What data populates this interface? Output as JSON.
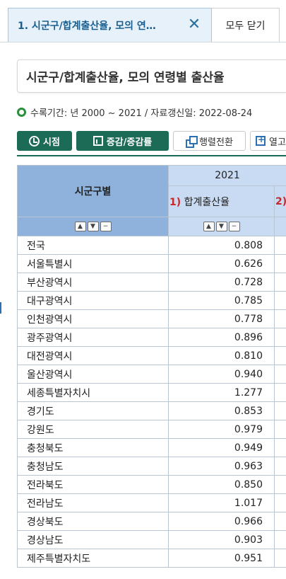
{
  "tabs": {
    "active_label": "1. 시군구/합계출산율, 모의 연…",
    "close_icon": "close-icon",
    "close_all_label": "모두 닫기"
  },
  "title": "시군구/합계출산율, 모의 연령별 출산율",
  "meta": {
    "text": "수록기간: 년 2000 ~ 2021 / 자료갱신일: 2022-08-24"
  },
  "toolbar": {
    "time_label": "시점",
    "change_label": "증감/증감률",
    "pivot_label": "행렬전환",
    "cols_label": "열고"
  },
  "table": {
    "region_header": "시군구별",
    "year": "2021",
    "col1_num": "1)",
    "col1_label": "합계출산율",
    "col2_num": "2)",
    "rows": [
      {
        "name": "전국",
        "value": "0.808"
      },
      {
        "name": "서울특별시",
        "value": "0.626"
      },
      {
        "name": "부산광역시",
        "value": "0.728"
      },
      {
        "name": "대구광역시",
        "value": "0.785"
      },
      {
        "name": "인천광역시",
        "value": "0.778"
      },
      {
        "name": "광주광역시",
        "value": "0.896"
      },
      {
        "name": "대전광역시",
        "value": "0.810"
      },
      {
        "name": "울산광역시",
        "value": "0.940"
      },
      {
        "name": "세종특별자치시",
        "value": "1.277"
      },
      {
        "name": "경기도",
        "value": "0.853"
      },
      {
        "name": "강원도",
        "value": "0.979"
      },
      {
        "name": "충청북도",
        "value": "0.949"
      },
      {
        "name": "충청남도",
        "value": "0.963"
      },
      {
        "name": "전라북도",
        "value": "0.850"
      },
      {
        "name": "전라남도",
        "value": "1.017"
      },
      {
        "name": "경상북도",
        "value": "0.966"
      },
      {
        "name": "경상남도",
        "value": "0.903"
      },
      {
        "name": "제주특별자치도",
        "value": "0.951"
      }
    ]
  },
  "colors": {
    "accent_green": "#1b6b57",
    "header_blue": "#8fb2dc",
    "header_light": "#c9dbf2",
    "note_red": "#c62828"
  }
}
